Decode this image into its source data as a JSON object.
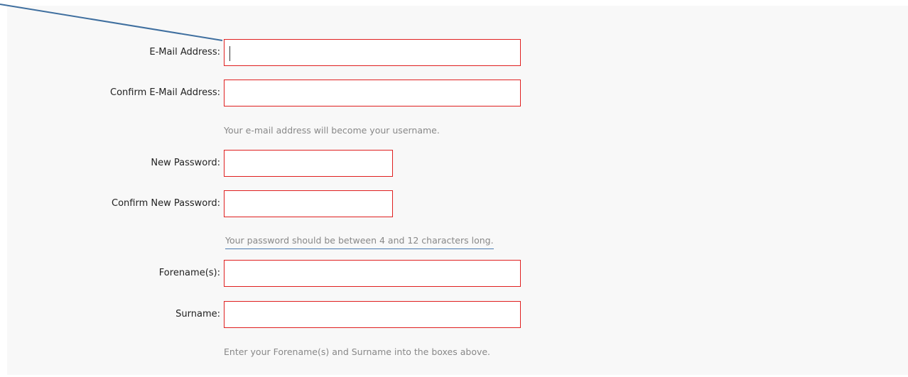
{
  "form": {
    "email": {
      "label": "E-Mail Address:",
      "value": ""
    },
    "confirm_email": {
      "label": "Confirm E-Mail Address:",
      "value": ""
    },
    "email_hint": "Your e-mail address will become your username.",
    "new_password": {
      "label": "New Password:",
      "value": ""
    },
    "confirm_password": {
      "label": "Confirm New Password:",
      "value": ""
    },
    "password_hint": "Your password should be between 4 and 12 characters long.",
    "forename": {
      "label": "Forename(s):",
      "value": ""
    },
    "surname": {
      "label": "Surname:",
      "value": ""
    },
    "name_hint": "Enter your Forename(s) and Surname into the boxes above."
  },
  "colors": {
    "field_border_invalid": "#e02020",
    "panel_background": "#f8f8f8",
    "hint_text": "#888888",
    "annotation_line": "#4a7ab0"
  }
}
